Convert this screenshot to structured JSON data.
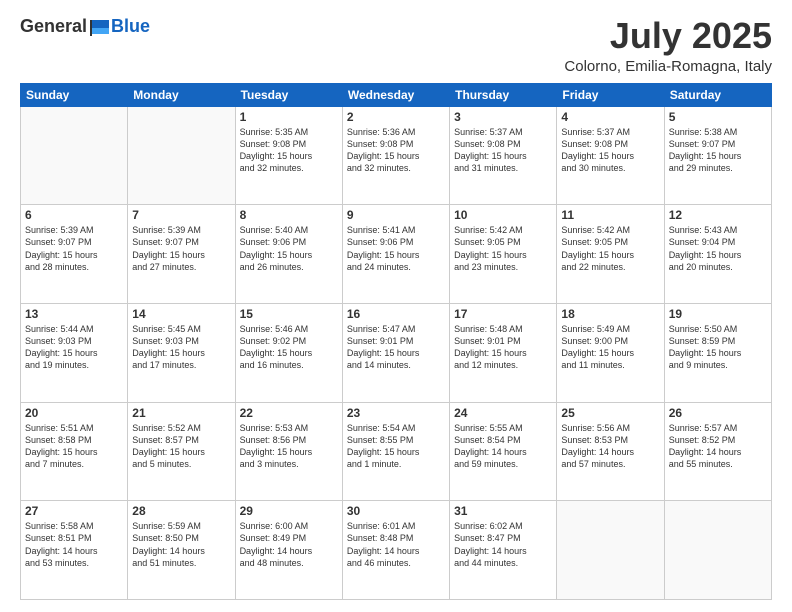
{
  "header": {
    "logo_general": "General",
    "logo_blue": "Blue",
    "month_title": "July 2025",
    "location": "Colorno, Emilia-Romagna, Italy"
  },
  "days_of_week": [
    "Sunday",
    "Monday",
    "Tuesday",
    "Wednesday",
    "Thursday",
    "Friday",
    "Saturday"
  ],
  "weeks": [
    [
      {
        "day": "",
        "info": ""
      },
      {
        "day": "",
        "info": ""
      },
      {
        "day": "1",
        "info": "Sunrise: 5:35 AM\nSunset: 9:08 PM\nDaylight: 15 hours\nand 32 minutes."
      },
      {
        "day": "2",
        "info": "Sunrise: 5:36 AM\nSunset: 9:08 PM\nDaylight: 15 hours\nand 32 minutes."
      },
      {
        "day": "3",
        "info": "Sunrise: 5:37 AM\nSunset: 9:08 PM\nDaylight: 15 hours\nand 31 minutes."
      },
      {
        "day": "4",
        "info": "Sunrise: 5:37 AM\nSunset: 9:08 PM\nDaylight: 15 hours\nand 30 minutes."
      },
      {
        "day": "5",
        "info": "Sunrise: 5:38 AM\nSunset: 9:07 PM\nDaylight: 15 hours\nand 29 minutes."
      }
    ],
    [
      {
        "day": "6",
        "info": "Sunrise: 5:39 AM\nSunset: 9:07 PM\nDaylight: 15 hours\nand 28 minutes."
      },
      {
        "day": "7",
        "info": "Sunrise: 5:39 AM\nSunset: 9:07 PM\nDaylight: 15 hours\nand 27 minutes."
      },
      {
        "day": "8",
        "info": "Sunrise: 5:40 AM\nSunset: 9:06 PM\nDaylight: 15 hours\nand 26 minutes."
      },
      {
        "day": "9",
        "info": "Sunrise: 5:41 AM\nSunset: 9:06 PM\nDaylight: 15 hours\nand 24 minutes."
      },
      {
        "day": "10",
        "info": "Sunrise: 5:42 AM\nSunset: 9:05 PM\nDaylight: 15 hours\nand 23 minutes."
      },
      {
        "day": "11",
        "info": "Sunrise: 5:42 AM\nSunset: 9:05 PM\nDaylight: 15 hours\nand 22 minutes."
      },
      {
        "day": "12",
        "info": "Sunrise: 5:43 AM\nSunset: 9:04 PM\nDaylight: 15 hours\nand 20 minutes."
      }
    ],
    [
      {
        "day": "13",
        "info": "Sunrise: 5:44 AM\nSunset: 9:03 PM\nDaylight: 15 hours\nand 19 minutes."
      },
      {
        "day": "14",
        "info": "Sunrise: 5:45 AM\nSunset: 9:03 PM\nDaylight: 15 hours\nand 17 minutes."
      },
      {
        "day": "15",
        "info": "Sunrise: 5:46 AM\nSunset: 9:02 PM\nDaylight: 15 hours\nand 16 minutes."
      },
      {
        "day": "16",
        "info": "Sunrise: 5:47 AM\nSunset: 9:01 PM\nDaylight: 15 hours\nand 14 minutes."
      },
      {
        "day": "17",
        "info": "Sunrise: 5:48 AM\nSunset: 9:01 PM\nDaylight: 15 hours\nand 12 minutes."
      },
      {
        "day": "18",
        "info": "Sunrise: 5:49 AM\nSunset: 9:00 PM\nDaylight: 15 hours\nand 11 minutes."
      },
      {
        "day": "19",
        "info": "Sunrise: 5:50 AM\nSunset: 8:59 PM\nDaylight: 15 hours\nand 9 minutes."
      }
    ],
    [
      {
        "day": "20",
        "info": "Sunrise: 5:51 AM\nSunset: 8:58 PM\nDaylight: 15 hours\nand 7 minutes."
      },
      {
        "day": "21",
        "info": "Sunrise: 5:52 AM\nSunset: 8:57 PM\nDaylight: 15 hours\nand 5 minutes."
      },
      {
        "day": "22",
        "info": "Sunrise: 5:53 AM\nSunset: 8:56 PM\nDaylight: 15 hours\nand 3 minutes."
      },
      {
        "day": "23",
        "info": "Sunrise: 5:54 AM\nSunset: 8:55 PM\nDaylight: 15 hours\nand 1 minute."
      },
      {
        "day": "24",
        "info": "Sunrise: 5:55 AM\nSunset: 8:54 PM\nDaylight: 14 hours\nand 59 minutes."
      },
      {
        "day": "25",
        "info": "Sunrise: 5:56 AM\nSunset: 8:53 PM\nDaylight: 14 hours\nand 57 minutes."
      },
      {
        "day": "26",
        "info": "Sunrise: 5:57 AM\nSunset: 8:52 PM\nDaylight: 14 hours\nand 55 minutes."
      }
    ],
    [
      {
        "day": "27",
        "info": "Sunrise: 5:58 AM\nSunset: 8:51 PM\nDaylight: 14 hours\nand 53 minutes."
      },
      {
        "day": "28",
        "info": "Sunrise: 5:59 AM\nSunset: 8:50 PM\nDaylight: 14 hours\nand 51 minutes."
      },
      {
        "day": "29",
        "info": "Sunrise: 6:00 AM\nSunset: 8:49 PM\nDaylight: 14 hours\nand 48 minutes."
      },
      {
        "day": "30",
        "info": "Sunrise: 6:01 AM\nSunset: 8:48 PM\nDaylight: 14 hours\nand 46 minutes."
      },
      {
        "day": "31",
        "info": "Sunrise: 6:02 AM\nSunset: 8:47 PM\nDaylight: 14 hours\nand 44 minutes."
      },
      {
        "day": "",
        "info": ""
      },
      {
        "day": "",
        "info": ""
      }
    ]
  ]
}
